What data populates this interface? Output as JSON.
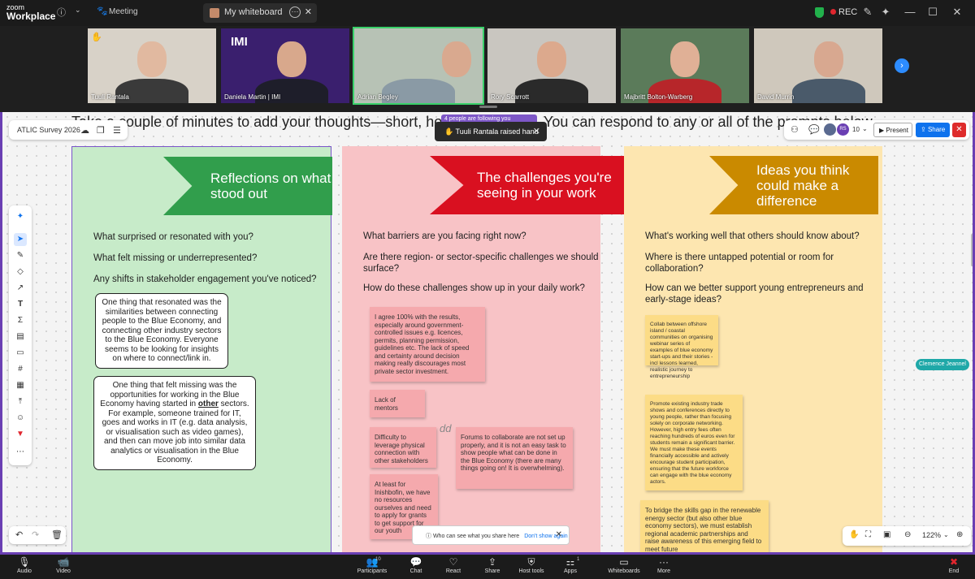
{
  "app": {
    "logo_line1": "zoom",
    "logo_line2": "Workplace",
    "meeting_label": "Meeting",
    "whiteboard_tab": "My whiteboard",
    "rec_label": "REC"
  },
  "participants": [
    {
      "name": "Tuuli Rantala"
    },
    {
      "name": "Daniela Martin | IMI"
    },
    {
      "name": "Adrian Begley"
    },
    {
      "name": "Rory Scarrott"
    },
    {
      "name": "Majbritt Bolton-Warberg"
    },
    {
      "name": "David Murrin"
    }
  ],
  "board": {
    "title": "ATLIC Survey 2026",
    "intro": "Take a couple of minutes to add your thoughts—short, honest and great. You can respond to any or all of the prompts below.",
    "following_text": "4 people are following you",
    "raised_hand": "Tuuli Rantala raised hand",
    "participant_count": "10",
    "avatar_initials": "RS",
    "present_label": "Present",
    "share_label": "Share",
    "cursor_label": "Clemence Jeannel",
    "share_tip": "Who can see what you share here",
    "share_tip_link": "Don't show again",
    "zoom_level": "122%",
    "columns": {
      "green": {
        "banner": "Reflections on what stood out",
        "q1": "What surprised or resonated with you?",
        "q2": "What felt missing or underrepresented?",
        "q3": "Any shifts in stakeholder engagement you've noticed?",
        "bubble1": "One thing that resonated was the similarities between connecting people to the Blue Economy, and connecting other industry sectors to the Blue Economy. Everyone seems to be looking for insights on where to connect/link in.",
        "bubble2_a": "One thing that felt missing was the opportunities for working in the Blue Economy having started in ",
        "bubble2_b": "other",
        "bubble2_c": " sectors. For example, someone trained for IT, goes and works in IT (e.g. data analysis, or visualisation such as video games), and then can move job into similar data analytics or visualisation in the Blue Economy."
      },
      "red": {
        "banner": "The challenges you're seeing in your work",
        "q1": "What barriers are you facing right now?",
        "q2": "Are there region- or sector-specific challenges we should surface?",
        "q3": "How do these challenges show up in your daily work?",
        "note1": "I agree 100% with the results, especially around government-controlled issues e.g. licences, permits, planning permission, guidelines etc.  The lack of speed and certainty around decision making really discourages most private sector investment.",
        "note2": "Lack of mentors",
        "note3": "Difficulty to leverage physical connection with other stakeholders",
        "note4": "Forums to collaborate are not set up properly, and it is not an easy task to show people what can be done in the Blue Economy (there are many things going on! It is overwhelming).",
        "note5": "At least for Inishbofin, we have no resources ourselves and need to apply for grants to get support for our youth",
        "dd": "dd"
      },
      "yellow": {
        "banner": "Ideas you think could make a difference",
        "q1": "What's working well that others should know about?",
        "q2": "Where is there untapped potential or room for collaboration?",
        "q3": "How can we better support young entrepreneurs and early-stage ideas?",
        "note1": "Collab between offshore island / coastal communities on organising webinar series of examples of blue economy start-ups and their stories - incl lessons learned, realistic journey to entrepreneurship",
        "note2": "Promote existing industry trade shows and conferences directly to young people, rather than focusing solely on corporate networking. However, high entry fees often reaching hundreds of euros even for students remain a significant barrier. We must make these events financially accessible and actively encourage student participation, ensuring that the future workforce can engage with the blue economy actors.",
        "note3": "To bridge the skills gap in the renewable energy sector (but also other blue economy sectors), we must establish regional academic partnerships and raise awareness of this emerging field to meet future"
      }
    }
  },
  "toolbar": {
    "audio": "Audio",
    "video": "Video",
    "participants": "Participants",
    "participants_count": "10",
    "chat": "Chat",
    "react": "React",
    "share": "Share",
    "host_tools": "Host tools",
    "apps": "Apps",
    "apps_count": "1",
    "whiteboards": "Whiteboards",
    "more": "More",
    "end": "End"
  },
  "colors": {
    "accent_purple": "#6a3fb3",
    "zoom_blue": "#0e72ed",
    "green_banner": "#319e4c",
    "red_banner": "#d91020",
    "yellow_banner": "#ca8a00"
  }
}
